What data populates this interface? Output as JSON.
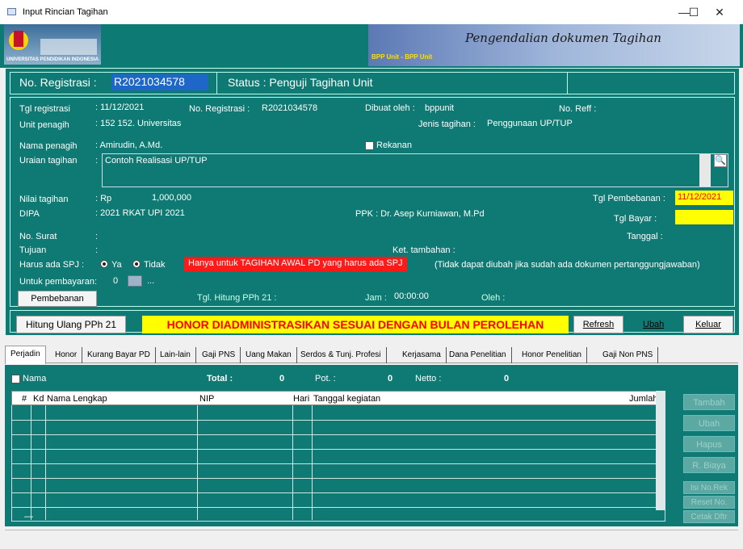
{
  "window": {
    "title": "Input Rincian Tagihan",
    "min_glyph": "—",
    "max_glyph": "☐",
    "close_glyph": "✕"
  },
  "banner": {
    "logo_text": "UNIVERSITAS PENDIDIKAN INDONESIA",
    "title": "Pengendalian dokumen Tagihan",
    "unit": "BPP Unit - BPP Unit"
  },
  "header": {
    "reg_label": "No. Registrasi  :",
    "reg_value": "R2021034578",
    "status": "Status :  Penguji Tagihan Unit"
  },
  "info": {
    "tgl_registrasi_label": "Tgl registrasi",
    "tgl_registrasi": ": 11/12/2021",
    "no_reg_label": "No. Registrasi :",
    "no_reg": "R2021034578",
    "dibuat_label": "Dibuat oleh :",
    "dibuat": "bppunit",
    "no_reff_label": "No. Reff :",
    "unit_label": "Unit penagih",
    "unit": ":  152    152. Universitas",
    "jenis_label": "Jenis tagihan :",
    "jenis": "Penggunaan UP/TUP",
    "nama_label": "Nama penagih",
    "nama": ":  Amirudin, A.Md.",
    "rekanan_label": "Rekanan",
    "uraian_label": "Uraian tagihan",
    "uraian_colon": ":",
    "uraian": "Contoh Realisasi UP/TUP",
    "nilai_label": "Nilai tagihan",
    "nilai_rp": ": Rp",
    "nilai": "1,000,000",
    "tgl_pembebanan_label": "Tgl Pembebanan :",
    "tgl_pembebanan": "11/12/2021",
    "dipa_label": "DIPA",
    "dipa": ":  2021     RKAT UPI 2021",
    "ppk": "PPK  :  Dr. Asep Kurniawan, M.Pd",
    "tgl_bayar_label": "Tgl Bayar :",
    "no_surat_label": "No. Surat",
    "no_surat_colon": ":",
    "tanggal_label": "Tanggal  :",
    "tujuan_label": "Tujuan",
    "tujuan_colon": ":",
    "ket_label": "Ket. tambahan  :",
    "spj_label": "Harus ada SPJ  :",
    "spj_ya": "Ya",
    "spj_tidak": "Tidak",
    "spj_note": "Hanya untuk TAGIHAN AWAL PD yang harus ada SPJ",
    "spj_note2": "(Tidak dapat diubah jika sudah ada dokumen pertanggungjawaban)",
    "untuk_label": "Untuk pembayaran:",
    "untuk_value": "0",
    "untuk_ellipsis": "...",
    "pembebanan_btn": "Pembebanan",
    "tgl_pph_label": "Tgl. Hitung PPh 21  :",
    "jam_label": "Jam  :",
    "jam": "00:00:00",
    "oleh_label": "Oleh  :"
  },
  "actions": {
    "hitung": "Hitung Ulang PPh 21",
    "honor_banner": "HONOR DIADMINISTRASIKAN SESUAI DENGAN BULAN PEROLEHAN",
    "refresh": "Refresh",
    "ubah": "Ubah",
    "keluar": "Keluar"
  },
  "tabs": [
    "Perjadin",
    "Honor",
    "Kurang Bayar PD",
    "Lain-lain",
    "Gaji PNS",
    "Uang Makan",
    "Serdos & Tunj. Profesi",
    "Kerjasama",
    "Dana Penelitian",
    "Honor Penelitian",
    "Gaji Non PNS"
  ],
  "summary": {
    "nama_label": "Nama",
    "total_label": "Total :",
    "total": "0",
    "pot_label": "Pot. :",
    "pot": "0",
    "netto_label": "Netto :",
    "netto": "0"
  },
  "grid": {
    "headers": [
      "#",
      "Kd",
      "Nama Lengkap",
      "NIP",
      "Hari",
      "Tanggal kegiatan",
      "Jumlah"
    ],
    "footer": "—"
  },
  "side_buttons": [
    "Tambah",
    "Ubah",
    "Hapus",
    "R. Biaya",
    "Isi No.Rek",
    "Reset No.",
    "Cetak Dftr"
  ]
}
